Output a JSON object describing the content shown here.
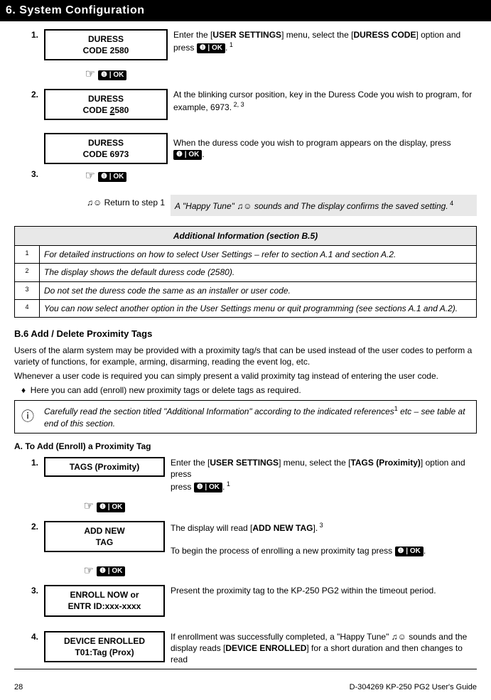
{
  "chapter": "6. System Configuration",
  "duress": {
    "step1_num": "1.",
    "box1_l1": "DURESS",
    "box1_l2": "CODE 2580",
    "desc1_a": "Enter the [",
    "desc1_b": "USER SETTINGS",
    "desc1_c": "] menu, select the [",
    "desc1_d": "DURESS CODE",
    "desc1_e": "] option and press ",
    "desc1_f": ".",
    "ref1": " 1",
    "step2_num": "2.",
    "box2_l1": "DURESS",
    "box2_l2a": "CODE ",
    "box2_l2b": "2",
    "box2_l2c": "580",
    "desc2": "At the blinking cursor position, key in the Duress Code you wish to program, for example, 6973.",
    "ref2": " 2, 3",
    "box3_l1": "DURESS",
    "box3_l2": "CODE 6973",
    "desc3_a": "When the duress code you wish to program appears on the display, press ",
    "desc3_b": ".",
    "step3_num": "3.",
    "return": " Return to step 1",
    "happy_a": "A \"Happy Tune\" ",
    "happy_b": " sounds and The display confirms the saved setting.",
    "ref4": " 4"
  },
  "ok_label": "❶ | OK",
  "addl": {
    "header": "Additional Information (section B.5)",
    "r1n": "1",
    "r1": "For detailed instructions on how to select User Settings – refer to section A.1 and section A.2.",
    "r2n": "2",
    "r2": "The display shows the default duress code (2580).",
    "r3n": "3",
    "r3": "Do not set the duress code the same as an installer or user code.",
    "r4n": "4",
    "r4": "You can now select another option in the User Settings menu or quit programming (see sections A.1 and A.2)."
  },
  "b6": {
    "title": "B.6 Add / Delete Proximity Tags",
    "p1": "Users of the alarm system may be provided with a proximity tag/s that can be used instead of the user codes to perform a variety of functions, for example, arming, disarming, reading the event log, etc.",
    "p2": "Whenever a user code is required you can simply present a valid proximity tag instead of entering the user code.",
    "p3": "Here you can add (enroll) new proximity tags or delete tags as required.",
    "info_a": "Carefully read the section titled \"Additional Information\" according to the indicated references",
    "info_sup": "1",
    "info_b": " etc – see table at end of this section."
  },
  "enroll": {
    "heading": "A. To Add (Enroll) a Proximity Tag",
    "s1n": "1.",
    "s1_box": "TAGS (Proximity)",
    "s1_a": "Enter the [",
    "s1_b": "USER SETTINGS",
    "s1_c": "] menu, select the [",
    "s1_d": "TAGS (Proximity)",
    "s1_e": "] option and press ",
    "s1_f": ".",
    "s1_ref": " 1",
    "s2n": "2.",
    "s2_box_l1": "ADD NEW",
    "s2_box_l2": "TAG",
    "s2_a": "The display will read [",
    "s2_b": "ADD NEW TAG",
    "s2_c": "].",
    "s2_ref": " 3",
    "s2_d": "To begin the process of enrolling a new proximity tag press ",
    "s2_e": ".",
    "s3n": "3.",
    "s3_box_l1": "ENROLL NOW or",
    "s3_box_l2": "ENTR ID:xxx-xxxx",
    "s3_desc": "Present the proximity tag to the KP-250 PG2 within the timeout period.",
    "s4n": "4.",
    "s4_box_l1": "DEVICE ENROLLED",
    "s4_box_l2": "T01:Tag (Prox)",
    "s4_a": "If enrollment was successfully completed, a \"Happy Tune\" ",
    "s4_b": " sounds and the display reads [",
    "s4_c": "DEVICE ENROLLED",
    "s4_d": "] for a short duration and then changes to read"
  },
  "footer": {
    "page": "28",
    "doc": "D-304269 KP-250 PG2 User's Guide"
  },
  "glyph": {
    "hand": "☞",
    "music": "♫☺"
  }
}
